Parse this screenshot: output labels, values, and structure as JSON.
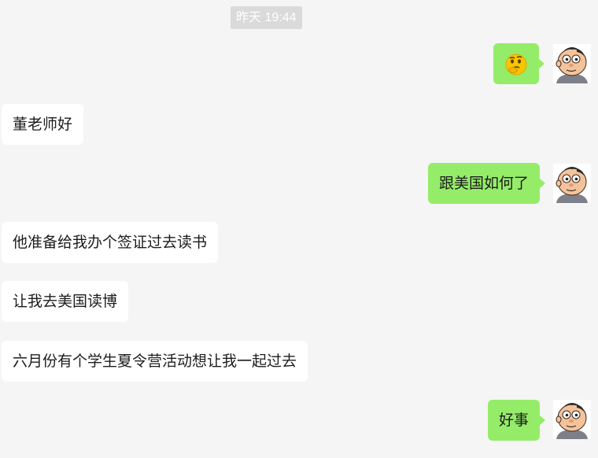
{
  "timestamp": "昨天 19:44",
  "messages": [
    {
      "side": "out",
      "type": "emoji",
      "icon": "thinking-face-emoji"
    },
    {
      "side": "in",
      "text": "董老师好"
    },
    {
      "side": "out",
      "text": "跟美国如何了"
    },
    {
      "side": "in",
      "text": "他准备给我办个签证过去读书"
    },
    {
      "side": "in",
      "text": "让我去美国读博"
    },
    {
      "side": "in",
      "text": "六月份有个学生夏令营活动想让我一起过去"
    },
    {
      "side": "out",
      "text": "好事"
    }
  ],
  "colors": {
    "background": "#f5f5f5",
    "incoming_bubble": "#ffffff",
    "outgoing_bubble": "#95ec69",
    "timestamp_badge": "#dadada"
  }
}
